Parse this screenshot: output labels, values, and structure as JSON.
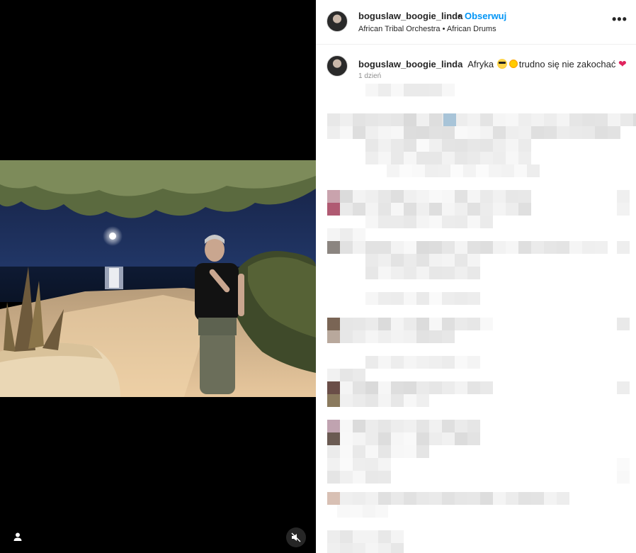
{
  "post": {
    "header": {
      "username": "boguslaw_boogie_linda",
      "separator": "•",
      "follow_label": "Obserwuj",
      "audio": "African Tribal Orchestra • African Drums",
      "more_icon": "more-options-icon"
    },
    "caption": {
      "username": "boguslaw_boogie_linda",
      "text_part1": "Afryka",
      "text_part2": "trudno się nie zakochać",
      "emojis": [
        "smiling-face-with-sunglasses",
        "sun-emoji",
        "red-heart"
      ],
      "timestamp": "1 dzień"
    }
  },
  "media": {
    "icons": [
      "user-tag-icon",
      "muted-speaker-icon"
    ]
  },
  "colors": {
    "follow_blue": "#0095f6",
    "text": "#262626",
    "muted": "#8e8e8e",
    "media_bg": "#000000"
  }
}
